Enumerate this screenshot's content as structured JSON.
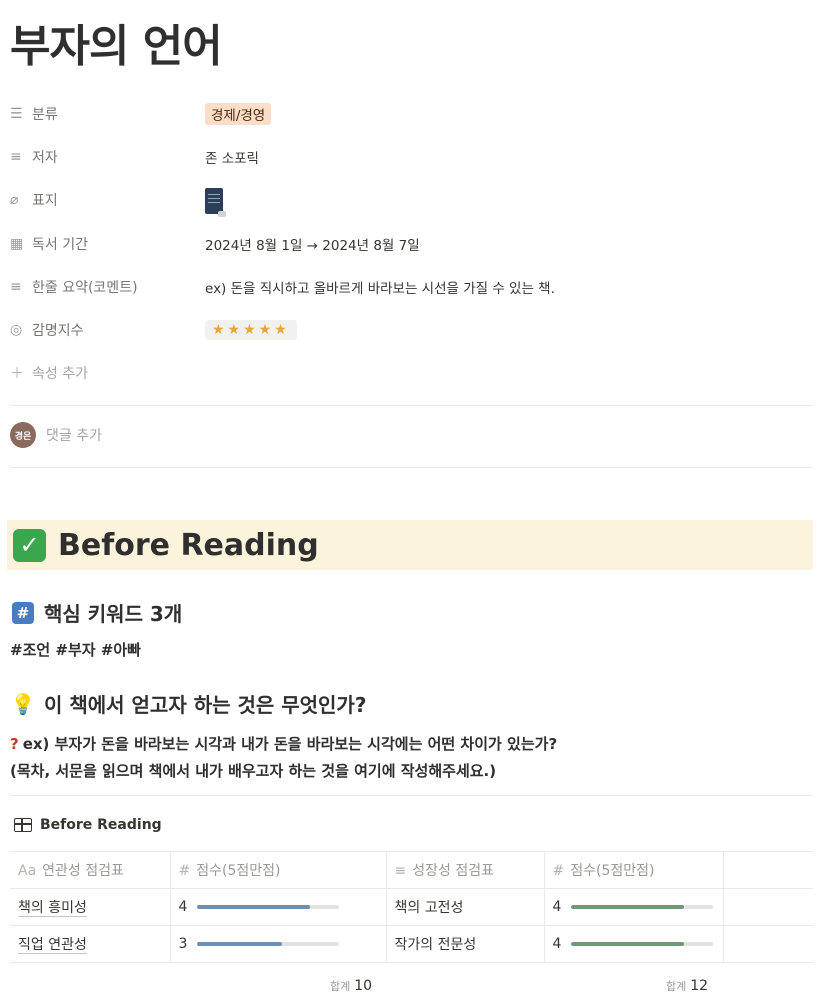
{
  "page": {
    "title": "부자의 언어"
  },
  "properties": [
    {
      "icon": "list-icon",
      "name": "분류",
      "type": "tag",
      "value": "경제/경영"
    },
    {
      "icon": "text-lines-icon",
      "name": "저자",
      "type": "text",
      "value": "존 소포릭"
    },
    {
      "icon": "paperclip-icon",
      "name": "표지",
      "type": "file",
      "value": ""
    },
    {
      "icon": "calendar-icon",
      "name": "독서 기간",
      "type": "text",
      "value": "2024년 8월 1일 → 2024년 8월 7일"
    },
    {
      "icon": "text-lines-icon",
      "name": "한줄 요약(코멘트)",
      "type": "text",
      "value": "ex) 돈을 직시하고 올바르게 바라보는 시선을 가질 수 있는 책."
    },
    {
      "icon": "circle-chevron-icon",
      "name": "감명지수",
      "type": "stars",
      "value": "★★★★★"
    }
  ],
  "add_property": {
    "icon": "plus-icon",
    "label": "속성 추가"
  },
  "comment": {
    "avatar_text": "경은",
    "placeholder": "댓글 추가"
  },
  "section": {
    "icon": "check-icon",
    "title": "Before Reading"
  },
  "keywords": {
    "icon": "hash-icon",
    "heading": "핵심 키워드 3개",
    "text": "#조언 #부자 #아빠"
  },
  "goal": {
    "icon": "lightbulb-icon",
    "heading": "이 책에서 얻고자 하는 것은 무엇인가?",
    "question": "ex) 부자가 돈을 바라보는 시각과 내가 돈을 바라보는 시각에는 어떤 차이가 있는가?",
    "note": "(목차, 서문을 읽으며 책에서 내가 배우고자 하는 것을 여기에 작성해주세요.)"
  },
  "database": {
    "title": "Before Reading",
    "columns": [
      {
        "icon": "Aa",
        "label": "연관성 점검표"
      },
      {
        "icon": "#",
        "label": "점수(5점만점)"
      },
      {
        "icon": "≡",
        "label": "성장성 점검표"
      },
      {
        "icon": "#",
        "label": "점수(5점만점)"
      }
    ],
    "rows": [
      {
        "c1": "책의 흥미성",
        "score1": 4,
        "c3": "책의 고전성",
        "score2": 4
      },
      {
        "c1": "직업 연관성",
        "score1": 3,
        "c3": "작가의 전문성",
        "score2": 4
      }
    ],
    "score_max": 5,
    "bar_colors": {
      "score1": "#6a8fb5",
      "score2": "#6e9a76"
    },
    "totals": {
      "label": "합계",
      "score1": "10",
      "score2": "12"
    }
  }
}
